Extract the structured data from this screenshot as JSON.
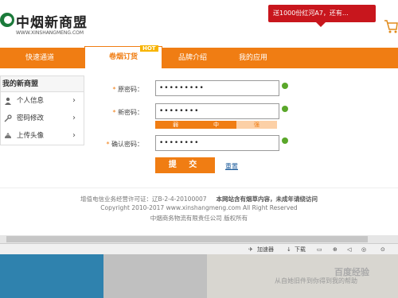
{
  "header": {
    "logo_text": "中烟新商盟",
    "logo_url_text": "WWW.XINSHANGMENG.COM",
    "promo_text": "送1000份红河A7，还有…"
  },
  "nav": {
    "items": [
      "快速通道",
      "卷烟订货",
      "品牌介绍",
      "我的应用"
    ],
    "hot_badge": "HOT"
  },
  "sidebar": {
    "title": "我的新商盟",
    "items": [
      {
        "label": "个人信息",
        "icon": "user-icon"
      },
      {
        "label": "密码修改",
        "icon": "key-icon"
      },
      {
        "label": "上传头像",
        "icon": "upload-icon"
      }
    ]
  },
  "form": {
    "old_label": "原密码：",
    "new_label": "新密码：",
    "confirm_label": "确认密码：",
    "old_value": "•••••••••",
    "new_value": "••••••••",
    "confirm_value": "••••••••",
    "strength": [
      "弱",
      "中",
      "强"
    ],
    "submit_label": "提 交",
    "reset_label": "重置"
  },
  "footer": {
    "icp": "增值电信业务经营许可证：辽B-2-4-20100007",
    "notice": "本网站含有烟草内容，未成年请绕访问",
    "copyright": "Copyright 2010-2017 www.xinshangmeng.com All Right Reserved",
    "company": "中烟商务物流有限责任公司 版权所有"
  },
  "browser_bar": {
    "speed_label": "加速器",
    "download_label": "下载"
  },
  "watermark": {
    "text": "从自她旧件到你得到我的帮助",
    "logo": "百度经验"
  },
  "colors": {
    "brand_orange": "#f07d13",
    "promo_red": "#c8161d",
    "ok_green": "#5aa72a"
  }
}
